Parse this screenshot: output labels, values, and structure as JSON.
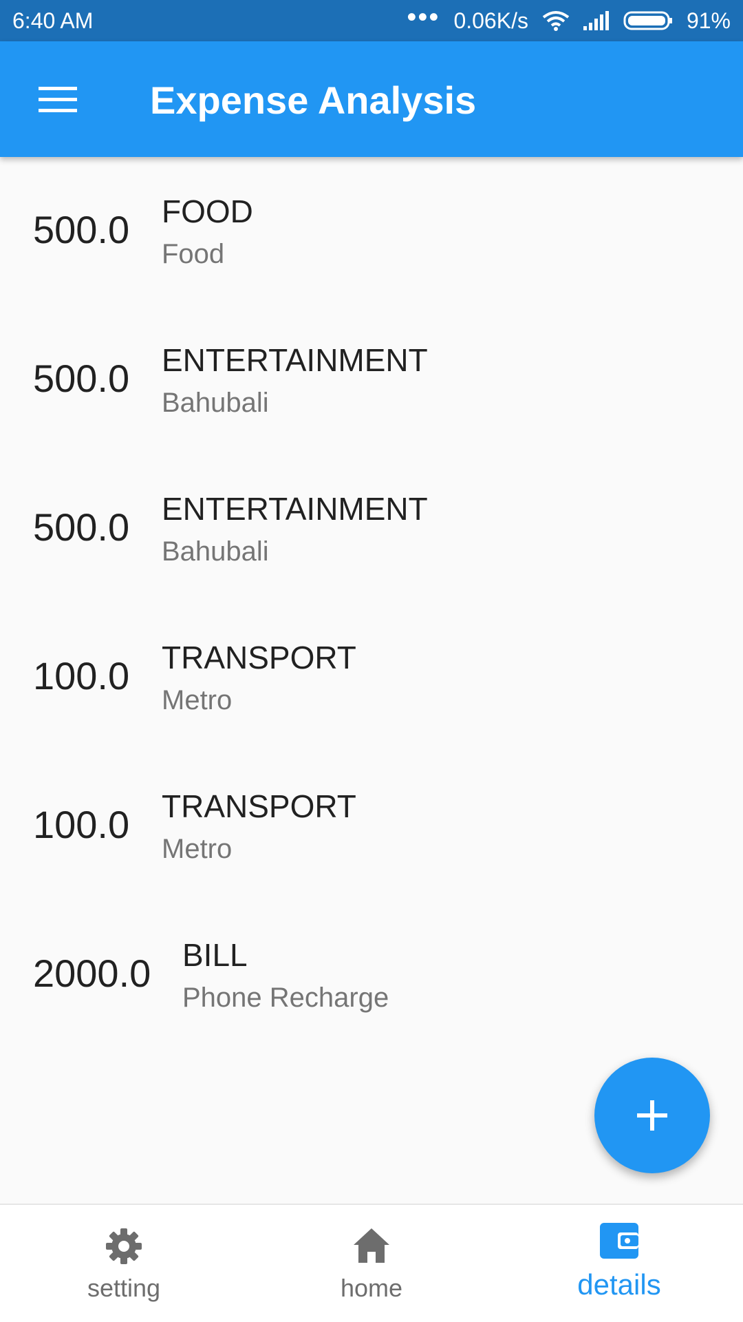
{
  "status_bar": {
    "time": "6:40  AM",
    "dots": "•••",
    "speed": "0.06K/s",
    "battery": "91%"
  },
  "app_bar": {
    "title": "Expense Analysis",
    "menu_icon": "hamburger-menu-icon"
  },
  "expenses": [
    {
      "amount": "500.0",
      "category": "FOOD",
      "note": "Food"
    },
    {
      "amount": "500.0",
      "category": "ENTERTAINMENT",
      "note": "Bahubali"
    },
    {
      "amount": "500.0",
      "category": "ENTERTAINMENT",
      "note": "Bahubali"
    },
    {
      "amount": "100.0",
      "category": "TRANSPORT",
      "note": "Metro"
    },
    {
      "amount": "100.0",
      "category": "TRANSPORT",
      "note": "Metro"
    },
    {
      "amount": "2000.0",
      "category": "BILL",
      "note": "Phone Recharge"
    }
  ],
  "fab": {
    "icon": "plus-icon"
  },
  "bottom_nav": {
    "items": [
      {
        "label": "setting",
        "icon": "gear-icon"
      },
      {
        "label": "home",
        "icon": "home-icon"
      },
      {
        "label": "details",
        "icon": "wallet-icon",
        "active": true
      }
    ]
  },
  "colors": {
    "primary": "#2196f3",
    "status_bar": "#1c6fb6",
    "inactive": "#6d6d6d"
  }
}
